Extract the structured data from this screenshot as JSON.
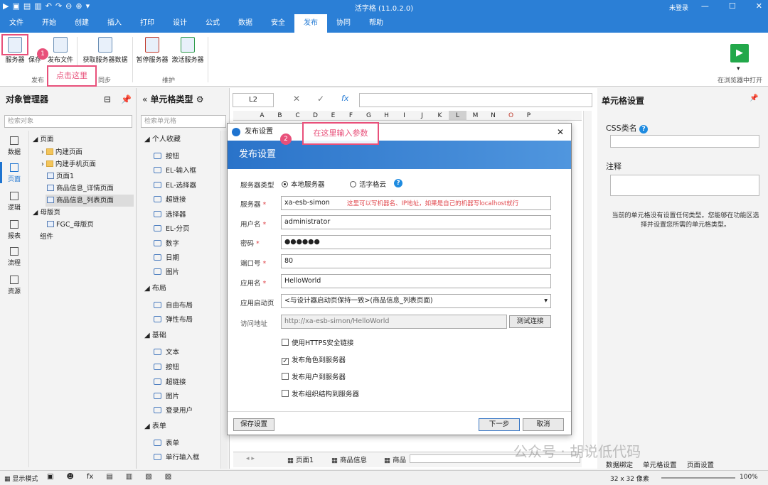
{
  "app": {
    "title": "活字格 (11.0.2.0)",
    "login": "未登录"
  },
  "menu": [
    "文件",
    "开始",
    "创建",
    "插入",
    "打印",
    "设计",
    "公式",
    "数据",
    "安全",
    "发布",
    "协同",
    "帮助"
  ],
  "menu_active": "发布",
  "ribbon": {
    "buttons": [
      "服务器",
      "保存",
      "发布文件",
      "获取服务器数据",
      "暂停服务器",
      "激活服务器"
    ],
    "groups": [
      "发布",
      "同步",
      "维护"
    ],
    "right_button": "在浏览器中打开"
  },
  "callouts": {
    "c1_num": "1",
    "c1_text": "点击这里",
    "c2_num": "2",
    "c2_text": "在这里输入参数"
  },
  "object_manager": {
    "title": "对象管理器",
    "search_placeholder": "检索对象",
    "side_views": [
      "数据",
      "页面",
      "逻辑",
      "报表",
      "流程",
      "资源"
    ],
    "tree": [
      "页面",
      "内建页面",
      "内建手机页面",
      "页面1",
      "商品信息_详情页面",
      "商品信息_列表页面",
      "母版页",
      "FGC_母版页",
      "组件"
    ]
  },
  "cell_types": {
    "title": "单元格类型",
    "search_placeholder": "检索单元格",
    "categories": [
      "个人收藏",
      "布局",
      "基础",
      "表单"
    ],
    "fav_items": [
      "按钮",
      "EL-输入框",
      "EL-选择器",
      "超链接",
      "选择器",
      "EL-分页",
      "数字",
      "日期",
      "图片"
    ],
    "layout_items": [
      "自由布局",
      "弹性布局"
    ],
    "basic_items": [
      "文本",
      "按钮",
      "超链接",
      "图片",
      "登录用户"
    ],
    "form_items": [
      "表单",
      "单行输入框"
    ]
  },
  "formula": {
    "cell_ref": "L2"
  },
  "columns": [
    "A",
    "B",
    "C",
    "D",
    "E",
    "F",
    "G",
    "H",
    "I",
    "J",
    "K",
    "L",
    "M",
    "N",
    "O",
    "P"
  ],
  "dialog": {
    "title": "发布设置",
    "banner": "发布设置",
    "server_type_label": "服务器类型",
    "server_type_options": [
      "本地服务器",
      "活字格云"
    ],
    "server_label": "服务器",
    "server_value": "xa-esb-simon",
    "server_hint": "这里可以写机器名、IP地址，如果是自己的机器写localhost就行",
    "user_label": "用户名",
    "user_value": "administrator",
    "password_label": "密码",
    "password_value": "●●●●●●",
    "port_label": "端口号",
    "port_value": "80",
    "app_label": "应用名",
    "app_value": "HelloWorld",
    "start_label": "应用启动页",
    "start_value": "<与设计器启动页保持一致>(商品信息_列表页面)",
    "url_label": "访问地址",
    "url_value": "http://xa-esb-simon/HelloWorld",
    "test_button": "测试连接",
    "checks": [
      "使用HTTPS安全链接",
      "发布角色到服务器",
      "发布用户到服务器",
      "发布组织结构到服务器"
    ],
    "save_button": "保存设置",
    "next_button": "下一步",
    "cancel_button": "取消"
  },
  "sheet_tabs": [
    "页面1",
    "商品信息",
    "商品"
  ],
  "right_panel": {
    "title": "单元格设置",
    "css_label": "CSS类名",
    "note_label": "注释",
    "message": "当前的单元格没有设置任何类型。您能够在功能区选择并设置您所需的单元格类型。"
  },
  "status": {
    "mode": "显示模式",
    "tabs": [
      "数据绑定",
      "单元格设置",
      "页面设置"
    ],
    "size": "32 x 32 像素",
    "zoom": "100%"
  },
  "watermark": "公众号 · 胡说低代码"
}
